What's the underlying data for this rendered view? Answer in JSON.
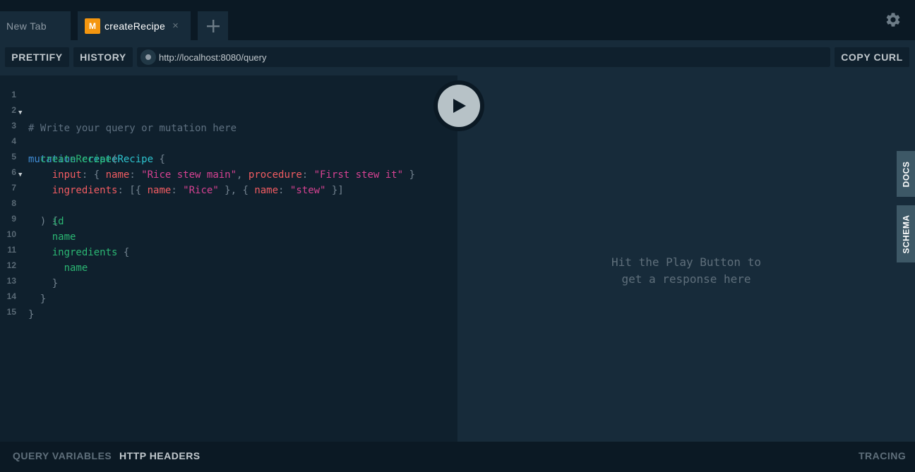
{
  "tabs": {
    "new_tab_label": "New Tab",
    "active": {
      "badge": "M",
      "title": "createRecipe",
      "close": "×"
    },
    "add": "+"
  },
  "toolbar": {
    "prettify": "PRETTIFY",
    "history": "HISTORY",
    "url": "http://localhost:8080/query",
    "copy_curl": "COPY CURL"
  },
  "editor": {
    "line_numbers": [
      "1",
      "2",
      "3",
      "4",
      "5",
      "6",
      "7",
      "8",
      "9",
      "10",
      "11",
      "12",
      "13",
      "14",
      "15"
    ],
    "tokens": {
      "l1": "# Write your query or mutation here",
      "l2_kw": "mutation",
      "l2_name": "createRecipe",
      "l2_brace": "{",
      "l3_field": "createRecipe",
      "l3_paren": "(",
      "l4_arg": "input",
      "l4_p1": ": { ",
      "l4_key1": "name",
      "l4_p2": ": ",
      "l4_str1": "\"Rice stew main\"",
      "l4_p3": ", ",
      "l4_key2": "procedure",
      "l4_p4": ": ",
      "l4_str2": "\"First stew it\"",
      "l4_p5": " }",
      "l5_arg": "ingredients",
      "l5_p1": ": [{ ",
      "l5_key1": "name",
      "l5_p2": ": ",
      "l5_str1": "\"Rice\"",
      "l5_p3": " }, { ",
      "l5_key2": "name",
      "l5_p4": ": ",
      "l5_str2": "\"stew\"",
      "l5_p5": " }]",
      "l6": ") {",
      "l7": "id",
      "l8": "name",
      "l9_field": "ingredients",
      "l9_brace": " {",
      "l10": "name",
      "l11": "}",
      "l12": "}",
      "l13": "}"
    }
  },
  "result": {
    "placeholder": "Hit the Play Button to\nget a response here"
  },
  "side_tabs": {
    "docs": "DOCS",
    "schema": "SCHEMA"
  },
  "bottom": {
    "query_variables": "QUERY VARIABLES",
    "http_headers": "HTTP HEADERS",
    "tracing": "TRACING"
  },
  "colors": {
    "badge": "#f4960f",
    "keyword": "#3f8cd4",
    "field": "#2bb673",
    "argument": "#f25c62",
    "string": "#d64292"
  },
  "icons": {
    "settings": "gear-icon",
    "play": "play-icon",
    "add_tab": "plus-icon",
    "close_tab": "close-icon",
    "fold": "fold-arrow-icon"
  }
}
